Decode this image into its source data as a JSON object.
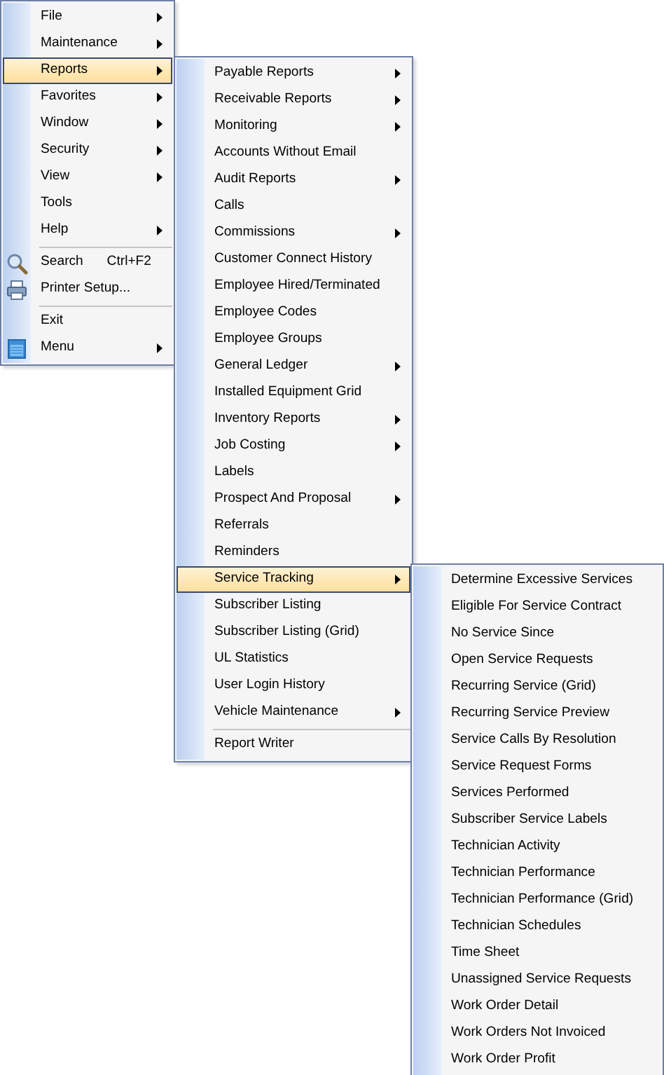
{
  "menus": [
    {
      "items": [
        {
          "kind": "item",
          "label": "File",
          "arrow": true,
          "selected": false
        },
        {
          "kind": "item",
          "label": "Maintenance",
          "arrow": true,
          "selected": false
        },
        {
          "kind": "item",
          "label": "Reports",
          "arrow": true,
          "selected": true
        },
        {
          "kind": "item",
          "label": "Favorites",
          "arrow": true,
          "selected": false
        },
        {
          "kind": "item",
          "label": "Window",
          "arrow": true,
          "selected": false
        },
        {
          "kind": "item",
          "label": "Security",
          "arrow": true,
          "selected": false
        },
        {
          "kind": "item",
          "label": "View",
          "arrow": true,
          "selected": false
        },
        {
          "kind": "item",
          "label": "Tools",
          "arrow": false,
          "selected": false
        },
        {
          "kind": "item",
          "label": "Help",
          "arrow": true,
          "selected": false
        },
        {
          "kind": "separator"
        },
        {
          "kind": "item",
          "label": "Search",
          "shortcut": "Ctrl+F2",
          "has_icon": true,
          "arrow": false,
          "selected": false
        },
        {
          "kind": "item",
          "label": "Printer Setup...",
          "has_icon": true,
          "arrow": false,
          "selected": false
        },
        {
          "kind": "separator"
        },
        {
          "kind": "item",
          "label": "Exit",
          "arrow": false,
          "selected": false
        },
        {
          "kind": "item",
          "label": "Menu",
          "has_icon": true,
          "arrow": true,
          "selected": false
        }
      ]
    },
    {
      "items": [
        {
          "kind": "item",
          "label": "Payable Reports",
          "arrow": true,
          "selected": false
        },
        {
          "kind": "item",
          "label": "Receivable Reports",
          "arrow": true,
          "selected": false
        },
        {
          "kind": "item",
          "label": "Monitoring",
          "arrow": true,
          "selected": false
        },
        {
          "kind": "item",
          "label": "Accounts Without Email",
          "arrow": false,
          "selected": false
        },
        {
          "kind": "item",
          "label": "Audit Reports",
          "arrow": true,
          "selected": false
        },
        {
          "kind": "item",
          "label": "Calls",
          "arrow": false,
          "selected": false
        },
        {
          "kind": "item",
          "label": "Commissions",
          "arrow": true,
          "selected": false
        },
        {
          "kind": "item",
          "label": "Customer Connect History",
          "arrow": false,
          "selected": false
        },
        {
          "kind": "item",
          "label": "Employee Hired/Terminated",
          "arrow": false,
          "selected": false
        },
        {
          "kind": "item",
          "label": "Employee Codes",
          "arrow": false,
          "selected": false
        },
        {
          "kind": "item",
          "label": "Employee Groups",
          "arrow": false,
          "selected": false
        },
        {
          "kind": "item",
          "label": "General Ledger",
          "arrow": true,
          "selected": false
        },
        {
          "kind": "item",
          "label": "Installed Equipment Grid",
          "arrow": false,
          "selected": false
        },
        {
          "kind": "item",
          "label": "Inventory Reports",
          "arrow": true,
          "selected": false
        },
        {
          "kind": "item",
          "label": "Job Costing",
          "arrow": true,
          "selected": false
        },
        {
          "kind": "item",
          "label": "Labels",
          "arrow": false,
          "selected": false
        },
        {
          "kind": "item",
          "label": "Prospect And Proposal",
          "arrow": true,
          "selected": false
        },
        {
          "kind": "item",
          "label": "Referrals",
          "arrow": false,
          "selected": false
        },
        {
          "kind": "item",
          "label": "Reminders",
          "arrow": false,
          "selected": false
        },
        {
          "kind": "item",
          "label": "Service Tracking",
          "arrow": true,
          "selected": true
        },
        {
          "kind": "item",
          "label": "Subscriber Listing",
          "arrow": false,
          "selected": false
        },
        {
          "kind": "item",
          "label": "Subscriber Listing (Grid)",
          "arrow": false,
          "selected": false
        },
        {
          "kind": "item",
          "label": "UL Statistics",
          "arrow": false,
          "selected": false
        },
        {
          "kind": "item",
          "label": "User Login History",
          "arrow": false,
          "selected": false
        },
        {
          "kind": "item",
          "label": "Vehicle Maintenance",
          "arrow": true,
          "selected": false
        },
        {
          "kind": "separator"
        },
        {
          "kind": "item",
          "label": "Report Writer",
          "arrow": false,
          "selected": false
        }
      ]
    },
    {
      "items": [
        {
          "kind": "item",
          "label": "Determine Excessive Services",
          "arrow": false,
          "selected": false
        },
        {
          "kind": "item",
          "label": "Eligible For Service Contract",
          "arrow": false,
          "selected": false
        },
        {
          "kind": "item",
          "label": "No Service Since",
          "arrow": false,
          "selected": false
        },
        {
          "kind": "item",
          "label": "Open Service Requests",
          "arrow": false,
          "selected": false
        },
        {
          "kind": "item",
          "label": "Recurring Service (Grid)",
          "arrow": false,
          "selected": false
        },
        {
          "kind": "item",
          "label": "Recurring Service Preview",
          "arrow": false,
          "selected": false
        },
        {
          "kind": "item",
          "label": "Service Calls By Resolution",
          "arrow": false,
          "selected": false
        },
        {
          "kind": "item",
          "label": "Service Request Forms",
          "arrow": false,
          "selected": false
        },
        {
          "kind": "item",
          "label": "Services Performed",
          "arrow": false,
          "selected": false
        },
        {
          "kind": "item",
          "label": "Subscriber Service Labels",
          "arrow": false,
          "selected": false
        },
        {
          "kind": "item",
          "label": "Technician Activity",
          "arrow": false,
          "selected": false
        },
        {
          "kind": "item",
          "label": "Technician Performance",
          "arrow": false,
          "selected": false
        },
        {
          "kind": "item",
          "label": "Technician Performance (Grid)",
          "arrow": false,
          "selected": false
        },
        {
          "kind": "item",
          "label": "Technician Schedules",
          "arrow": false,
          "selected": false
        },
        {
          "kind": "item",
          "label": "Time Sheet",
          "arrow": false,
          "selected": false
        },
        {
          "kind": "item",
          "label": "Unassigned Service Requests",
          "arrow": false,
          "selected": false
        },
        {
          "kind": "item",
          "label": "Work Order Detail",
          "arrow": false,
          "selected": false
        },
        {
          "kind": "item",
          "label": "Work Orders Not Invoiced",
          "arrow": false,
          "selected": false
        },
        {
          "kind": "item",
          "label": "Work Order Profit",
          "arrow": false,
          "selected": false
        }
      ]
    }
  ]
}
